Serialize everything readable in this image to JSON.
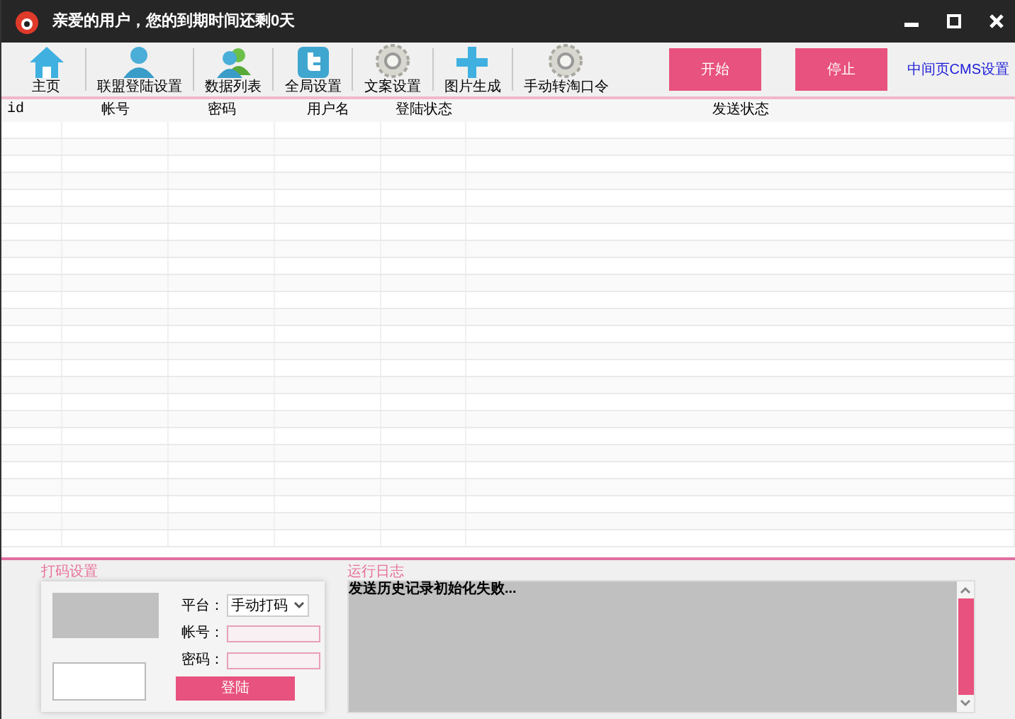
{
  "window": {
    "title": "亲爱的用户，您的到期时间还剩0天"
  },
  "toolbar": [
    {
      "kind": "home",
      "label": "主页"
    },
    {
      "kind": "user",
      "label": "联盟登陆设置"
    },
    {
      "kind": "users",
      "label": "数据列表"
    },
    {
      "kind": "bird",
      "label": "全局设置"
    },
    {
      "kind": "gear",
      "label": "文案设置"
    },
    {
      "kind": "plus",
      "label": "图片生成"
    },
    {
      "kind": "gear",
      "label": "手动转淘口令"
    }
  ],
  "actions": {
    "start": "开始",
    "stop": "停止",
    "link": "中间页CMS设置"
  },
  "table": {
    "columns": [
      "id",
      "帐号",
      "密码",
      "用户名",
      "登陆状态",
      "发送状态"
    ]
  },
  "captcha": {
    "title": "打码设置",
    "platform_label": "平台：",
    "platform_value": "手动打码",
    "account_label": "帐号：",
    "password_label": "密码：",
    "login": "登陆"
  },
  "log": {
    "title": "运行日志",
    "text": "发送历史记录初始化失败..."
  }
}
